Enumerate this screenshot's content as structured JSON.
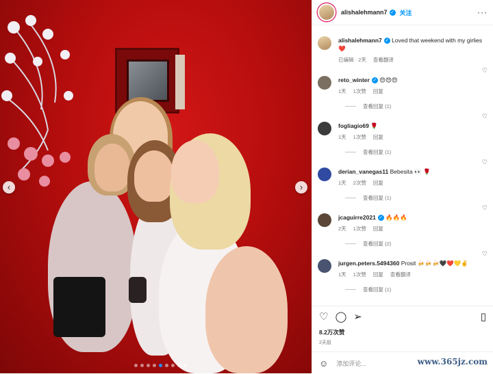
{
  "post": {
    "author": "alishalehmann7",
    "follow_label": "关注",
    "caption_text": "Loved that weekend with my girlies ❤️",
    "caption_meta": [
      "已编辑 · 2天",
      "查看翻译"
    ],
    "likes": "8.2万次赞",
    "posted": "2天前",
    "add_comment_placeholder": "添加评论..."
  },
  "comments": [
    {
      "user": "reto_winter",
      "verified": true,
      "text": "😍😍😍",
      "meta": [
        "1天",
        "1次赞",
        "回复"
      ],
      "replies": "查看回复 (1)"
    },
    {
      "user": "fogliagio69",
      "verified": false,
      "text": "🌹",
      "meta": [
        "1天",
        "1次赞",
        "回复"
      ],
      "replies": "查看回复 (1)"
    },
    {
      "user": "derian_vanegas11",
      "verified": false,
      "text": "Bebesita 👀 🌹",
      "meta": [
        "1天",
        "2次赞",
        "回复"
      ],
      "replies": "查看回复 (1)"
    },
    {
      "user": "jcaguirre2021",
      "verified": true,
      "text": "🔥🔥🔥",
      "meta": [
        "2天",
        "1次赞",
        "回复"
      ],
      "replies": "查看回复 (2)"
    },
    {
      "user": "jurgen.peters.5494360",
      "verified": false,
      "text": "Prosit 🍻🍻🍻🖤❤️💛✌️",
      "meta": [
        "1天",
        "1次赞",
        "回复",
        "查看翻译"
      ],
      "replies": "查看回复 (1)"
    }
  ],
  "watermark": "www.365jz.com",
  "colors": {
    "accent": "#0095f6",
    "story_ring": "#e1306c",
    "photo_red": "#c10f0f"
  }
}
